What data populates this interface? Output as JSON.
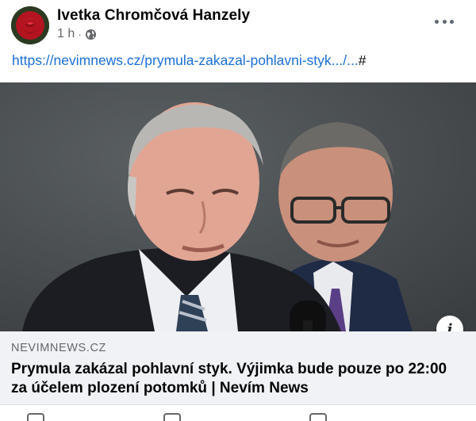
{
  "post": {
    "author": "Ivetka Chromčová Hanzely",
    "time": "1 h",
    "separator": "·",
    "privacy_icon": "globe-icon",
    "more_icon": "more-options-icon",
    "link_text": "https://nevimnews.cz/prymula-zakazal-pohlavni-styk.../...",
    "hash_text": "#"
  },
  "preview": {
    "domain": "NEVIMNEWS.CZ",
    "title": "Prymula zakázal pohlavní styk. Výjimka bude pouze po 22:00 za účelem plození potomků | Nevím News",
    "info_icon": "info-icon",
    "info_glyph": "i"
  },
  "colors": {
    "link": "#1a6fd6",
    "text": "#050505",
    "secondary": "#65676b",
    "preview_bg": "#f0f2f5"
  }
}
